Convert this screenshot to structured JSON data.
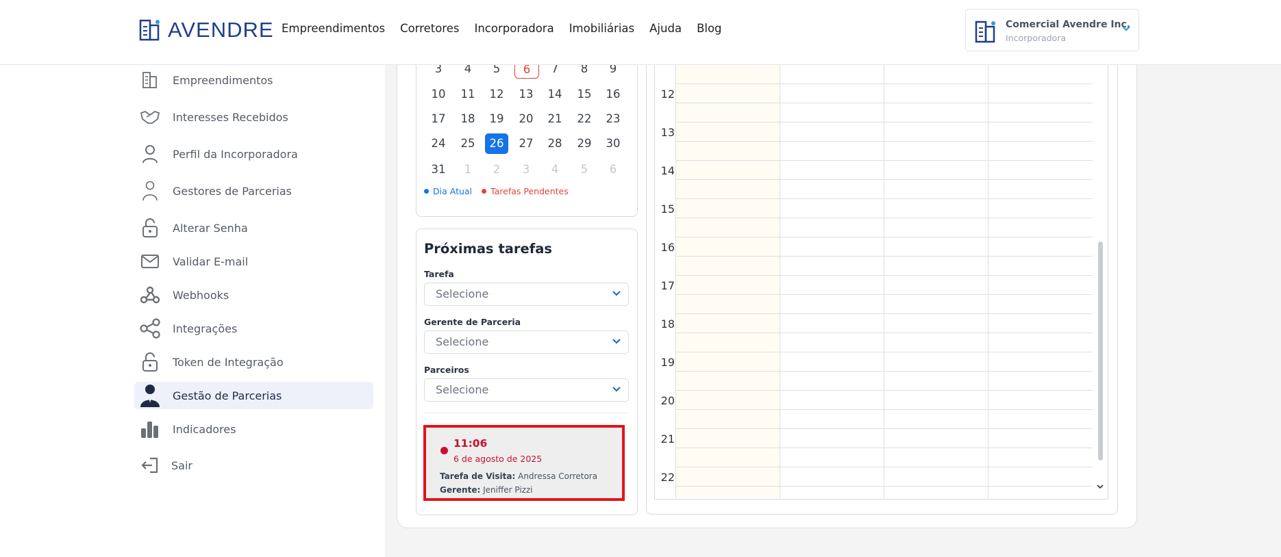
{
  "brand": {
    "name": "AVENDRE"
  },
  "nav": [
    "Empreendimentos",
    "Corretores",
    "Incorporadora",
    "Imobiliárias",
    "Ajuda",
    "Blog"
  ],
  "account": {
    "name": "Comercial Avendre Inc.",
    "role": "Incorporadora"
  },
  "sidebar": {
    "items": [
      {
        "label": "Empreendimentos",
        "icon": "building-icon"
      },
      {
        "label": "Interesses Recebidos",
        "icon": "handshake-icon"
      },
      {
        "label": "Perfil da Incorporadora",
        "icon": "user-icon"
      },
      {
        "label": "Gestores de Parcerias",
        "icon": "user-outline-icon"
      },
      {
        "label": "Alterar Senha",
        "icon": "unlock-icon"
      },
      {
        "label": "Validar E-mail",
        "icon": "mail-icon"
      },
      {
        "label": "Webhooks",
        "icon": "webhook-icon"
      },
      {
        "label": "Integrações",
        "icon": "share-icon"
      },
      {
        "label": "Token de Integração",
        "icon": "unlock-icon"
      },
      {
        "label": "Gestão de Parcerias",
        "icon": "manager-icon",
        "active": true
      },
      {
        "label": "Indicadores",
        "icon": "bar-chart-icon"
      },
      {
        "label": "Sair",
        "icon": "logout-icon"
      }
    ]
  },
  "calendar": {
    "weeks": [
      [
        "3",
        "4",
        "5",
        "6",
        "7",
        "8",
        "9"
      ],
      [
        "10",
        "11",
        "12",
        "13",
        "14",
        "15",
        "16"
      ],
      [
        "17",
        "18",
        "19",
        "20",
        "21",
        "22",
        "23"
      ],
      [
        "24",
        "25",
        "26",
        "27",
        "28",
        "29",
        "30"
      ],
      [
        "31",
        "1",
        "2",
        "3",
        "4",
        "5",
        "6"
      ]
    ],
    "today": "26",
    "pending_day": "6",
    "legend": {
      "today": "Dia Atual",
      "pending": "Tarefas Pendentes"
    },
    "colors": {
      "today": "#1473e6",
      "pending": "#e0443a"
    }
  },
  "tasks": {
    "title": "Próximas tarefas",
    "filters": [
      {
        "label": "Tarefa",
        "placeholder": "Selecione"
      },
      {
        "label": "Gerente de Parceria",
        "placeholder": "Selecione"
      },
      {
        "label": "Parceiros",
        "placeholder": "Selecione"
      }
    ],
    "item": {
      "time": "11:06",
      "date": "6 de agosto de 2025",
      "type_label": "Tarefa de Visita:",
      "type_value": "Andressa Corretora",
      "manager_label": "Gerente:",
      "manager_value": "Jeniffer Pizzi",
      "highlight_color": "#e3141c"
    }
  },
  "schedule": {
    "hours": [
      "12",
      "13",
      "14",
      "15",
      "16",
      "17",
      "18",
      "19",
      "20",
      "21",
      "22"
    ]
  }
}
